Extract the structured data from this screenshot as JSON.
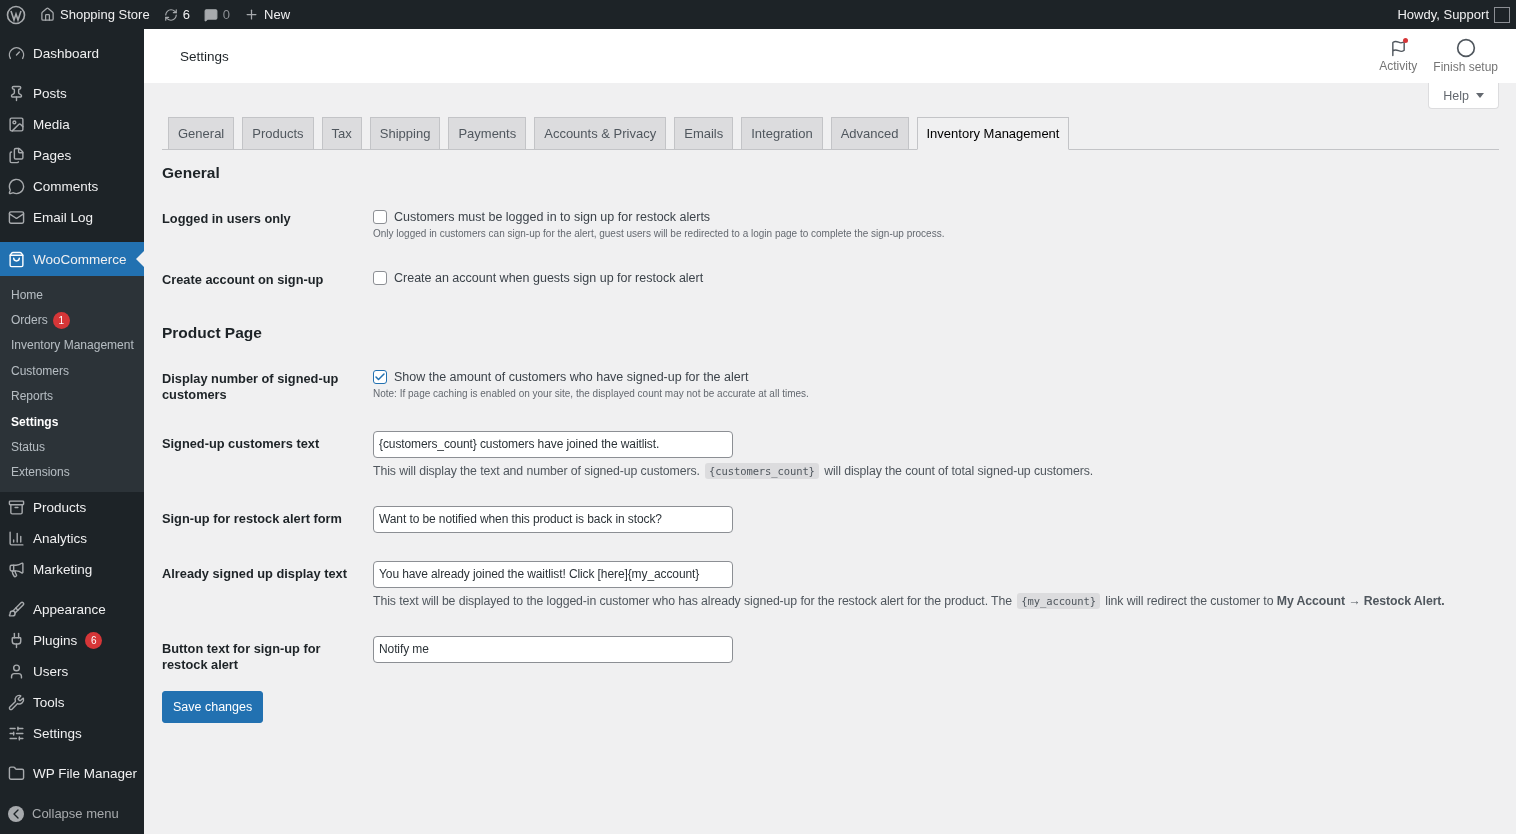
{
  "admin_bar": {
    "site_name": "Shopping Store",
    "updates_count": "6",
    "comments_count": "0",
    "new_label": "New",
    "greeting": "Howdy, Support"
  },
  "sidebar": {
    "groups": [
      [
        {
          "label": "Dashboard",
          "selected": false
        }
      ],
      [
        {
          "label": "Posts",
          "selected": false
        },
        {
          "label": "Media",
          "selected": false
        },
        {
          "label": "Pages",
          "selected": false
        },
        {
          "label": "Comments",
          "selected": false
        },
        {
          "label": "Email Log",
          "selected": false
        }
      ],
      [
        {
          "label": "WooCommerce",
          "selected": true,
          "children": [
            {
              "label": "Home",
              "selected": false
            },
            {
              "label": "Orders",
              "selected": false,
              "badge": "1"
            },
            {
              "label": "Inventory Management",
              "selected": false
            },
            {
              "label": "Customers",
              "selected": false
            },
            {
              "label": "Reports",
              "selected": false
            },
            {
              "label": "Settings",
              "selected": true
            },
            {
              "label": "Status",
              "selected": false
            },
            {
              "label": "Extensions",
              "selected": false
            }
          ]
        },
        {
          "label": "Products",
          "selected": false
        },
        {
          "label": "Analytics",
          "selected": false
        },
        {
          "label": "Marketing",
          "selected": false
        }
      ],
      [
        {
          "label": "Appearance",
          "selected": false
        },
        {
          "label": "Plugins",
          "selected": false,
          "badge": "6"
        },
        {
          "label": "Users",
          "selected": false
        },
        {
          "label": "Tools",
          "selected": false
        },
        {
          "label": "Settings",
          "selected": false
        }
      ],
      [
        {
          "label": "WP File Manager",
          "selected": false
        }
      ]
    ],
    "collapse_label": "Collapse menu"
  },
  "header": {
    "title": "Settings",
    "actions": [
      {
        "label": "Activity",
        "unread": true
      },
      {
        "label": "Finish setup",
        "unread": false
      }
    ],
    "help_label": "Help"
  },
  "tabs": [
    {
      "label": "General",
      "selected": false
    },
    {
      "label": "Products",
      "selected": false
    },
    {
      "label": "Tax",
      "selected": false
    },
    {
      "label": "Shipping",
      "selected": false
    },
    {
      "label": "Payments",
      "selected": false
    },
    {
      "label": "Accounts & Privacy",
      "selected": false
    },
    {
      "label": "Emails",
      "selected": false
    },
    {
      "label": "Integration",
      "selected": false
    },
    {
      "label": "Advanced",
      "selected": false
    },
    {
      "label": "Inventory Management",
      "selected": true
    }
  ],
  "sections": [
    {
      "heading": "General",
      "fields": [
        {
          "kind": "checkbox",
          "label": "Logged in users only",
          "checked": false,
          "option_label": "Customers must be logged in to sign up for restock alerts",
          "description": [
            {
              "kind": "text",
              "text": "Only logged in customers can sign-up for the alert, guest users will be redirected to a login page to complete the sign-up process."
            }
          ]
        },
        {
          "kind": "checkbox",
          "label": "Create account on sign-up",
          "checked": false,
          "option_label": "Create an account when guests sign up for restock alert"
        }
      ]
    },
    {
      "heading": "Product Page",
      "fields": [
        {
          "kind": "checkbox",
          "label": "Display number of signed-up customers",
          "checked": true,
          "option_label": "Show the amount of customers who have signed-up for the alert",
          "description": [
            {
              "kind": "text",
              "text": "Note: If page caching is enabled on your site, the displayed count may not be accurate at all times."
            }
          ]
        },
        {
          "kind": "text",
          "label": "Signed-up customers text",
          "value": "{customers_count} customers have joined the waitlist.",
          "description": [
            {
              "kind": "text",
              "text": "This will display the text and number of signed-up customers. "
            },
            {
              "kind": "code",
              "text": "{customers_count}"
            },
            {
              "kind": "text",
              "text": " will display the count of total signed-up customers."
            }
          ]
        },
        {
          "kind": "text",
          "label": "Sign-up for restock alert form",
          "value": "Want to be notified when this product is back in stock?"
        },
        {
          "kind": "text",
          "label": "Already signed up display text",
          "value": "You have already joined the waitlist! Click [here]{my_account}",
          "description": [
            {
              "kind": "text",
              "text": "This text will be displayed to the logged-in customer who has already signed-up for the restock alert for the product. The "
            },
            {
              "kind": "code",
              "text": "{my_account}"
            },
            {
              "kind": "text",
              "text": " link will redirect the customer to **My Account → Restock Alert.**"
            }
          ]
        },
        {
          "kind": "text",
          "label": "Button text for sign-up for restock alert",
          "value": "Notify me"
        }
      ]
    }
  ],
  "save_label": "Save changes"
}
